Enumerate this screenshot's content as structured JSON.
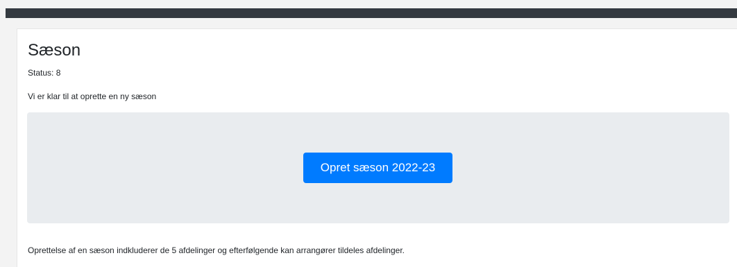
{
  "season": {
    "title": "Sæson",
    "status_text": "Status: 8",
    "intro_text": "Vi er klar til at oprette en ny sæson",
    "create_button_label": "Opret sæson 2022-23",
    "footer_text": "Oprettelse af en sæson indkluderer de 5 afdelinger og efterfølgende kan arrangører tildeles afdelinger."
  },
  "colors": {
    "topbar": "#343a40",
    "page_background": "#f3f3f3",
    "card_background": "#ffffff",
    "jumbotron_background": "#e9ecef",
    "button_primary": "#007bff",
    "button_text": "#ffffff"
  }
}
